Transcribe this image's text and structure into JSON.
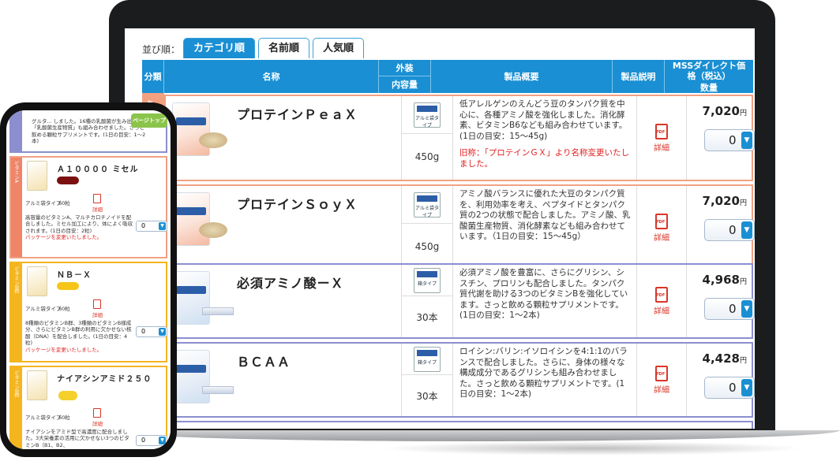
{
  "laptop": {
    "sort": {
      "label": "並び順：",
      "tabs": [
        "カテゴリ順",
        "名前順",
        "人気順"
      ]
    },
    "table_header": {
      "category": "分類",
      "name": "名称",
      "package": "外装",
      "content": "内容量",
      "overview": "製品概要",
      "description": "製品説明",
      "price": "MSSダイレクト価格（税込）",
      "quantity": "数量"
    },
    "category_label": "タ",
    "products": [
      {
        "name": "プロテインＰｅａＸ",
        "package_type": "アルミ袋タイプ",
        "amount": "450g",
        "description": "低アレルゲンのえんどう豆のタンパク質を中心に、各種アミノ酸を強化しました。消化酵素、ビタミンB6なども組み合わせています。(1日の目安：15～45g)",
        "note": "旧称：「プロテインＧＸ」より名称変更いたしました。",
        "detail": "詳細",
        "price": "7,020",
        "price_unit": "円",
        "qty": "0"
      },
      {
        "name": "プロテインＳｏｙＸ",
        "package_type": "アルミ袋タイプ",
        "amount": "450g",
        "description": "アミノ酸バランスに優れた大豆のタンパク質を、利用効率を考え、ペプタイドとタンパク質の2つの状態で配合しました。アミノ酸、乳酸菌生産物質、消化酵素なども組み合わせています。（1日の目安：15～45g）",
        "note": "",
        "detail": "詳細",
        "price": "7,020",
        "price_unit": "円",
        "qty": "0"
      },
      {
        "name": "必須アミノ酸ーＸ",
        "package_type": "箱タイプ",
        "amount": "30本",
        "description": "必須アミノ酸を豊富に、さらにグリシン、シスチン、プロリンも配合しました。タンパク質代謝を助ける3つのビタミンBを強化しています。さっと飲める顆粒サプリメントです。(1日の目安：1～2本)",
        "note": "",
        "detail": "詳細",
        "price": "4,968",
        "price_unit": "円",
        "qty": "0"
      },
      {
        "name": "ＢＣＡＡ",
        "package_type": "箱タイプ",
        "amount": "30本",
        "description": "ロイシン:バリン:イソロイシンを4:1:1のバランスで配合しました。さらに、身体の様々な構成成分であるグリシンも組み合わせました。さっと飲める顆粒サプリメントです。(1日の目安：1～2本)",
        "note": "",
        "detail": "詳細",
        "price": "4,428",
        "price_unit": "円",
        "qty": "0"
      }
    ]
  },
  "phone": {
    "top_text": "グルタ... しました。16種の乳酸菌が生み出した「乳酸菌生産物質」も組み合わせました。さっと飲める顆粒サプリメントです。(1日の目安：1～2本)",
    "page_top": "ページトップ",
    "items": [
      {
        "category": "ビタミンA",
        "name": "Ａ１００００ ミセル",
        "package_type": "アルミ袋タイプ",
        "amount": "60粒",
        "detail": "詳細",
        "description": "高容量のビタミンA、マルチカロチノイドを配合しました。ミセル加工により、体によく吸収されます。(1日の目安：2粒)",
        "note": "パッケージを変更いたしました。",
        "qty": "0"
      },
      {
        "category": "ビタミンB群",
        "name": "ＮＢ－Ｘ",
        "package_type": "アルミ袋タイプ",
        "amount": "60粒",
        "detail": "詳細",
        "description": "8種類のビタミンB群、3種類のビタミンB様成分、さらにビタミンB群の利用に欠かせない核酸（DNA）を配合しました。(1日の目安：4粒)",
        "note": "パッケージを変更いたしました。",
        "qty": "0"
      },
      {
        "category": "ビタミンB群",
        "name": "ナイアシンアミド２５０",
        "package_type": "アルミ袋タイプ",
        "amount": "60粒",
        "detail": "詳細",
        "description": "ナイアシンをアミド型で高濃度に配合しました。3大栄養素の活用に欠かせない3つのビタミンB（B1、B2、",
        "note": "",
        "qty": "0"
      }
    ]
  },
  "colors": {
    "accent_blue": "#1a8fd3",
    "salmon_border": "#f0a184",
    "purple_border": "#8b8fcf",
    "yellow_border": "#f5b51f",
    "note_red": "#e02020"
  }
}
